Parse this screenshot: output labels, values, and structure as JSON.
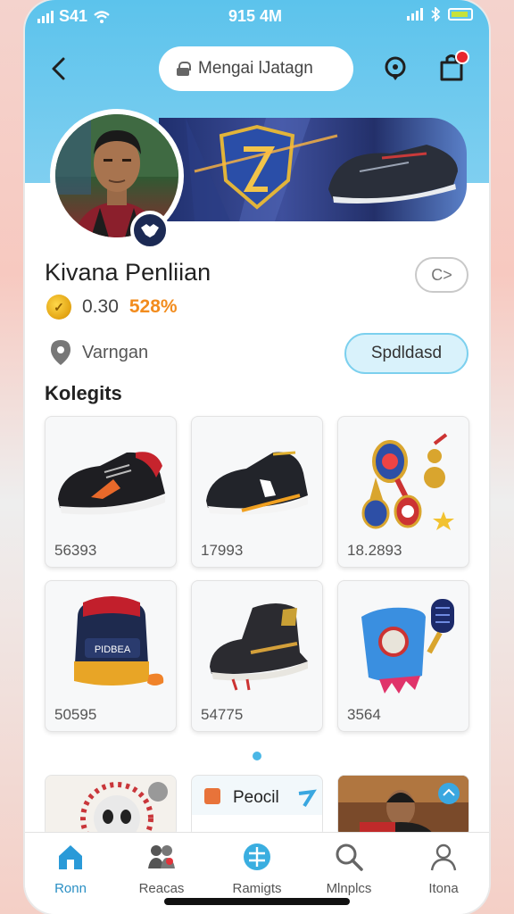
{
  "status_bar": {
    "carrier": "S41",
    "time": "915 4M"
  },
  "header": {
    "search_text": "Mengai lJatagn",
    "back_icon": "chevron-left-icon",
    "location_icon": "location-pin-icon",
    "cart_icon": "shopping-bag-icon"
  },
  "profile": {
    "name": "Kivana Penliian",
    "coin_value_a": "0.30",
    "coin_value_b": "528%",
    "follow_label": "C>",
    "location": "Varngan",
    "action_label": "Spdldasd"
  },
  "section": {
    "title": "Kolegits"
  },
  "items": [
    {
      "value": "56393",
      "image": "sneaker-red-black"
    },
    {
      "value": "17993",
      "image": "sneaker-black-white"
    },
    {
      "value": "18.2893",
      "image": "medals-ribbons"
    },
    {
      "value": "50595",
      "image": "backpack"
    },
    {
      "value": "54775",
      "image": "high-top-sneaker"
    },
    {
      "value": "3564",
      "image": "bag-and-microphone"
    }
  ],
  "promos": [
    {
      "label": "",
      "image": "panda-sticker"
    },
    {
      "label": "Peocil",
      "image": "pencil-card"
    },
    {
      "label": "",
      "image": "person-photo"
    }
  ],
  "tabs": [
    {
      "label": "Ronn",
      "icon": "home-icon",
      "active": true
    },
    {
      "label": "Reacas",
      "icon": "community-icon",
      "active": false
    },
    {
      "label": "Ramigts",
      "icon": "grid-icon",
      "active": false
    },
    {
      "label": "Mlnplcs",
      "icon": "search-icon",
      "active": false
    },
    {
      "label": "Itona",
      "icon": "person-icon",
      "active": false
    }
  ],
  "colors": {
    "header": "#5cc3ec",
    "accent": "#2a8fc4",
    "coin_highlight": "#f28c1e",
    "badge": "#e8262d"
  }
}
